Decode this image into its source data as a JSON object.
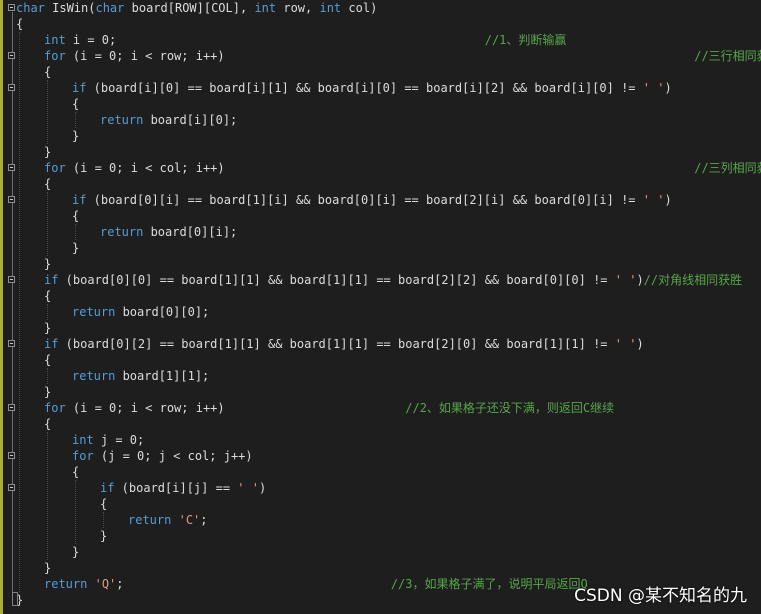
{
  "editor": {
    "lines": [
      [
        {
          "t": "char",
          "c": "kw"
        },
        {
          "t": " IsWin("
        },
        {
          "t": "char",
          "c": "kw"
        },
        {
          "t": " board[ROW][COL], "
        },
        {
          "t": "int",
          "c": "kw"
        },
        {
          "t": " row, "
        },
        {
          "t": "int",
          "c": "kw"
        },
        {
          "t": " col)"
        }
      ],
      [
        {
          "t": "{"
        }
      ],
      [
        {
          "t": "int",
          "c": "kw"
        },
        {
          "t": " i = 0;                                                   "
        },
        {
          "t": "//1、判断输赢",
          "c": "cm"
        }
      ],
      [
        {
          "t": "for",
          "c": "kw"
        },
        {
          "t": " (i = 0; i < row; i++)                                                                 "
        },
        {
          "t": "//三行相同获胜",
          "c": "cm"
        }
      ],
      [
        {
          "t": "{"
        }
      ],
      [
        {
          "t": "if",
          "c": "kw"
        },
        {
          "t": " (board[i][0] == board[i][1] && board[i][0] == board[i][2] && board[i][0] != "
        },
        {
          "t": "' '",
          "c": "str"
        },
        {
          "t": ")"
        }
      ],
      [
        {
          "t": "{"
        }
      ],
      [
        {
          "t": "return",
          "c": "kw"
        },
        {
          "t": " board[i][0];"
        }
      ],
      [
        {
          "t": "}"
        }
      ],
      [
        {
          "t": "}"
        }
      ],
      [
        {
          "t": "for",
          "c": "kw"
        },
        {
          "t": " (i = 0; i < col; i++)                                                                 "
        },
        {
          "t": "//三列相同获胜",
          "c": "cm"
        }
      ],
      [
        {
          "t": "{"
        }
      ],
      [
        {
          "t": "if",
          "c": "kw"
        },
        {
          "t": " (board[0][i] == board[1][i] && board[0][i] == board[2][i] && board[0][i] != "
        },
        {
          "t": "' '",
          "c": "str"
        },
        {
          "t": ")"
        }
      ],
      [
        {
          "t": "{"
        }
      ],
      [
        {
          "t": "return",
          "c": "kw"
        },
        {
          "t": " board[0][i];"
        }
      ],
      [
        {
          "t": "}"
        }
      ],
      [
        {
          "t": "}"
        }
      ],
      [
        {
          "t": "if",
          "c": "kw"
        },
        {
          "t": " (board[0][0] == board[1][1] && board[1][1] == board[2][2] && board[0][0] != "
        },
        {
          "t": "' '",
          "c": "str"
        },
        {
          "t": ")"
        },
        {
          "t": "//对角线相同获胜",
          "c": "cm"
        }
      ],
      [
        {
          "t": "{"
        }
      ],
      [
        {
          "t": "return",
          "c": "kw"
        },
        {
          "t": " board[0][0];"
        }
      ],
      [
        {
          "t": "}"
        }
      ],
      [
        {
          "t": "if",
          "c": "kw"
        },
        {
          "t": " (board[0][2] == board[1][1] && board[1][1] == board[2][0] && board[1][1] != "
        },
        {
          "t": "' '",
          "c": "str"
        },
        {
          "t": ")"
        }
      ],
      [
        {
          "t": "{"
        }
      ],
      [
        {
          "t": "return",
          "c": "kw"
        },
        {
          "t": " board[1][1];"
        }
      ],
      [
        {
          "t": "}"
        }
      ],
      [
        {
          "t": "for",
          "c": "kw"
        },
        {
          "t": " (i = 0; i < row; i++)                         "
        },
        {
          "t": "//2、如果格子还没下满，则返回C继续",
          "c": "cm"
        }
      ],
      [
        {
          "t": "{"
        }
      ],
      [
        {
          "t": "int",
          "c": "kw"
        },
        {
          "t": " j = 0;"
        }
      ],
      [
        {
          "t": "for",
          "c": "kw"
        },
        {
          "t": " (j = 0; j < col; j++)"
        }
      ],
      [
        {
          "t": "{"
        }
      ],
      [
        {
          "t": "if",
          "c": "kw"
        },
        {
          "t": " (board[i][j] == "
        },
        {
          "t": "' '",
          "c": "str"
        },
        {
          "t": ")"
        }
      ],
      [
        {
          "t": "{"
        }
      ],
      [
        {
          "t": "return",
          "c": "kw"
        },
        {
          "t": " "
        },
        {
          "t": "'C'",
          "c": "str"
        },
        {
          "t": ";"
        }
      ],
      [
        {
          "t": "}"
        }
      ],
      [
        {
          "t": "}"
        }
      ],
      [
        {
          "t": "}"
        }
      ],
      [
        {
          "t": "return",
          "c": "kw"
        },
        {
          "t": " "
        },
        {
          "t": "'Q'",
          "c": "str"
        },
        {
          "t": ";                                     "
        },
        {
          "t": "//3，如果格子满了，说明平局返回Q",
          "c": "cm"
        }
      ],
      [
        {
          "t": "}"
        }
      ]
    ]
  },
  "watermark": "CSDN @某不知名的九",
  "colors": {
    "background": "#1e1e1e",
    "keyword": "#569cd6",
    "comment": "#57a64a",
    "string": "#d69d85",
    "text": "#dcdcdc"
  }
}
